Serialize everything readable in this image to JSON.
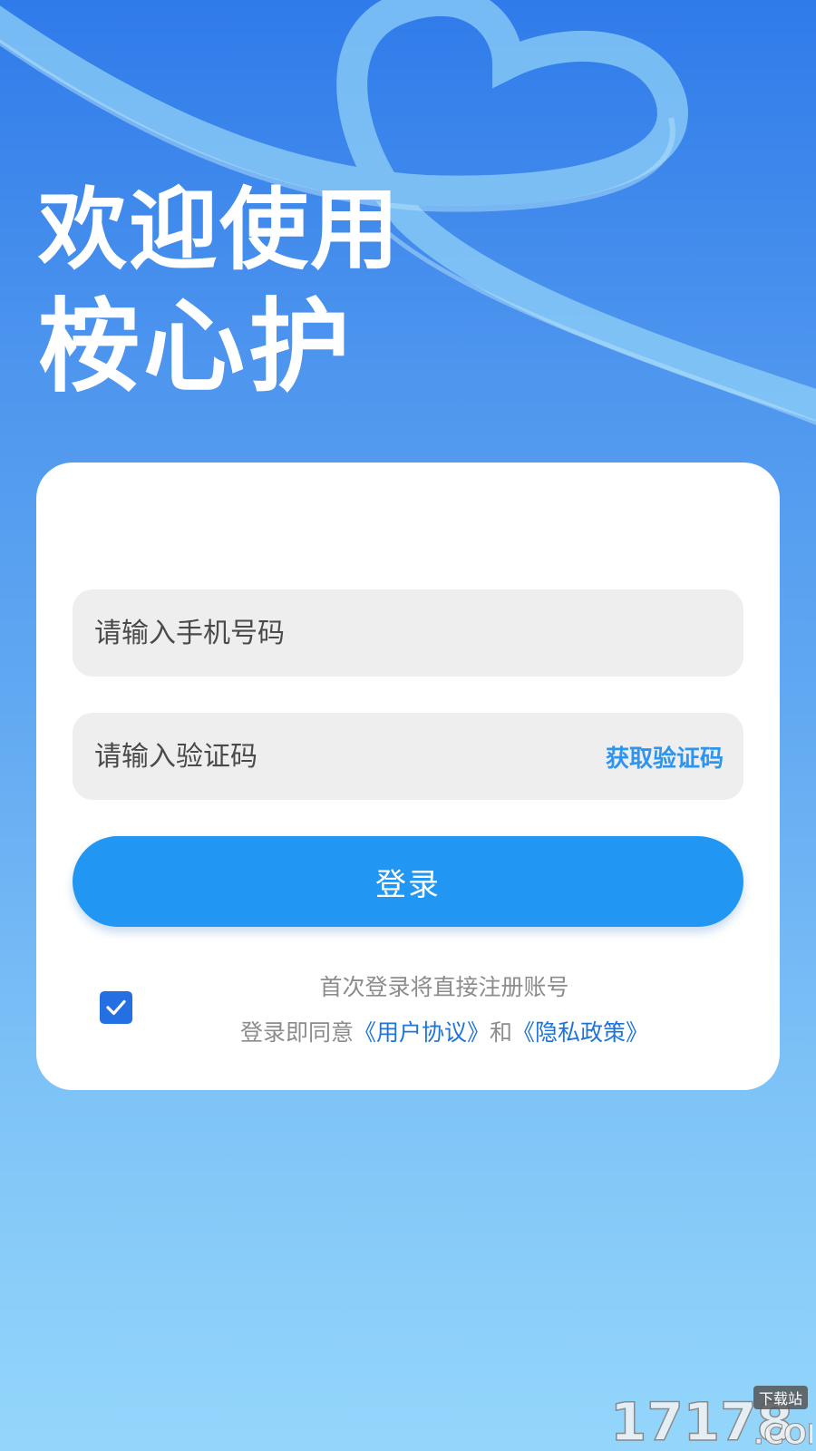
{
  "welcome": {
    "line1": "欢迎使用",
    "line2": "桉心护"
  },
  "form": {
    "phone_placeholder": "请输入手机号码",
    "code_placeholder": "请输入验证码",
    "get_code_label": "获取验证码",
    "login_label": "登录"
  },
  "agreement": {
    "checked": true,
    "line1": "首次登录将直接注册账号",
    "prefix": "登录即同意",
    "user_agreement": "《用户协议》",
    "conjunction": "和",
    "privacy_policy": "《隐私政策》"
  },
  "watermark": {
    "main": "17178",
    "sub": ".COM",
    "tag": "下载站"
  },
  "colors": {
    "primary": "#2196f3",
    "link": "#1f74dc",
    "checkbox": "#2470e3",
    "get_code": "#2d95f0"
  }
}
